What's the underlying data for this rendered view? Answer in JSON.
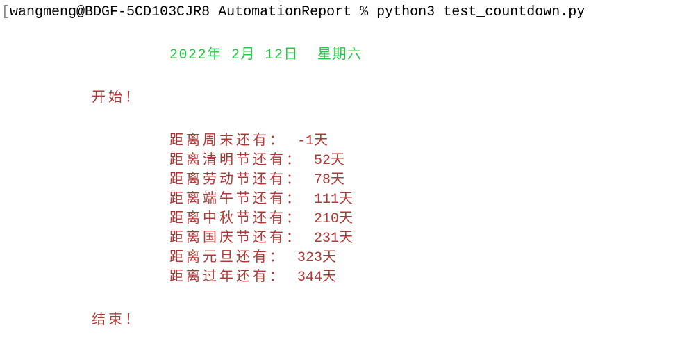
{
  "prompt": {
    "user": "wangmeng",
    "host": "BDGF-5CD103CJR8",
    "cwd": "AutomationReport",
    "symbol": "%",
    "command": "python3 test_countdown.py"
  },
  "date_header": "2022年 2月 12日  星期六",
  "start_label": "开始！",
  "end_label": "结束！",
  "countdown_template": {
    "prefix": "距离",
    "suffix": "还有：",
    "unit": "天"
  },
  "countdowns": [
    {
      "name": "周末",
      "days": -1
    },
    {
      "name": "清明节",
      "days": 52
    },
    {
      "name": "劳动节",
      "days": 78
    },
    {
      "name": "端午节",
      "days": 111
    },
    {
      "name": "中秋节",
      "days": 210
    },
    {
      "name": "国庆节",
      "days": 231
    },
    {
      "name": "元旦",
      "days": 323
    },
    {
      "name": "过年",
      "days": 344
    }
  ]
}
